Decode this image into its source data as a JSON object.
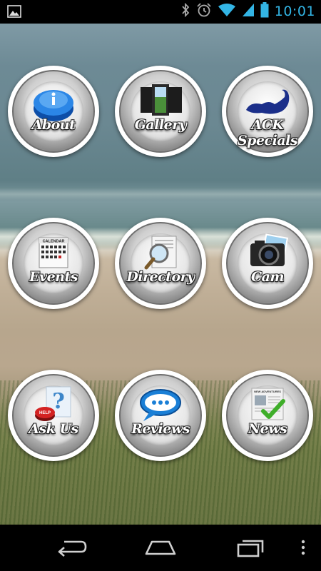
{
  "status_bar": {
    "time": "10:01",
    "icons": [
      "image-notification-icon",
      "bluetooth-icon",
      "alarm-icon",
      "wifi-icon",
      "signal-icon",
      "battery-icon"
    ]
  },
  "grid": {
    "tiles": [
      {
        "label": "About",
        "icon": "info-button-icon"
      },
      {
        "label": "Gallery",
        "icon": "photo-frames-icon"
      },
      {
        "label": "ACK Specials",
        "icon": "island-map-icon"
      },
      {
        "label": "Events",
        "icon": "calendar-icon"
      },
      {
        "label": "Directory",
        "icon": "magnifier-document-icon"
      },
      {
        "label": "Cam",
        "icon": "camera-icon"
      },
      {
        "label": "Ask Us",
        "icon": "help-button-icon"
      },
      {
        "label": "Reviews",
        "icon": "speech-bubble-icon"
      },
      {
        "label": "News",
        "icon": "newspaper-check-icon"
      }
    ]
  },
  "art_text": {
    "calendar_header": "CALENDAR",
    "help_badge": "HELP",
    "newspaper_masthead": "NEW ADVENTURES"
  },
  "navbar": {
    "icons": [
      "back-icon",
      "home-icon",
      "recent-apps-icon",
      "menu-icon"
    ]
  },
  "colors": {
    "status_accent": "#33b5e5",
    "label_text": "#ffffff",
    "info_blue": "#1f73d6",
    "check_green": "#3fae2a"
  }
}
